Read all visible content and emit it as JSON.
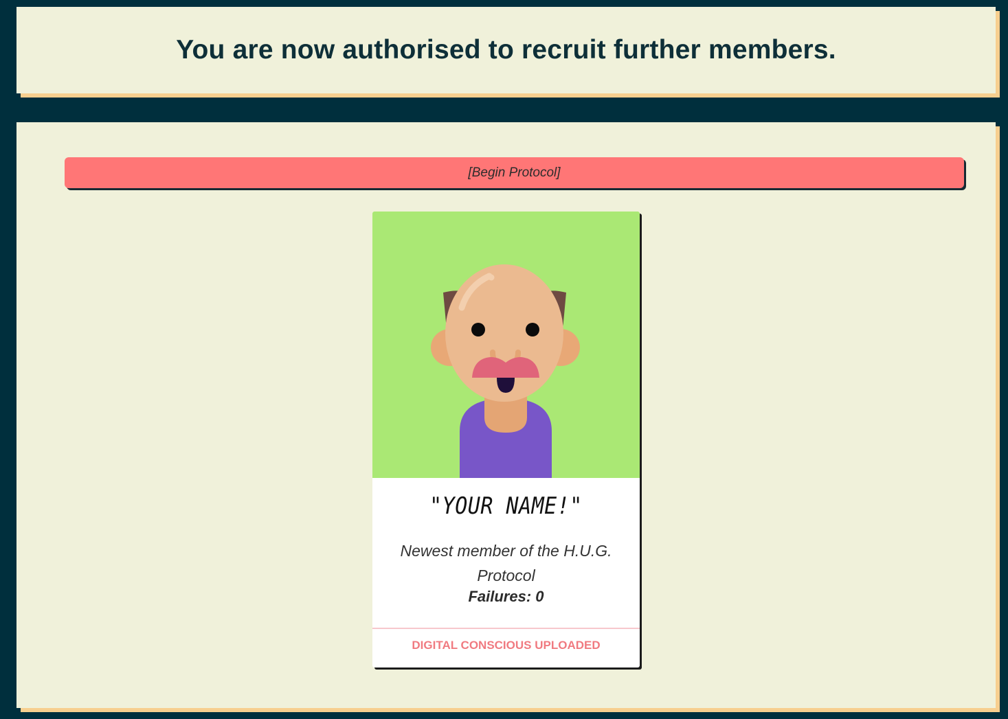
{
  "header": {
    "title": "You are now authorised to recruit further members."
  },
  "main": {
    "begin_button": {
      "label": "[Begin Protocol]"
    },
    "card": {
      "avatar_icon": "bald-man-mustache-avatar",
      "name": "\"YOUR NAME!\"",
      "description": "Newest member of the H.U.G. Protocol",
      "failures": "Failures: 0",
      "action_label": "DIGITAL CONSCIOUS UPLOADED"
    }
  },
  "colors": {
    "background": "#002f3d",
    "panel": "#f0f1da",
    "panel_shadow": "#f7cf8f",
    "button": "#ff7676",
    "avatar_bg": "#aae874",
    "action_text": "#f07a80"
  }
}
